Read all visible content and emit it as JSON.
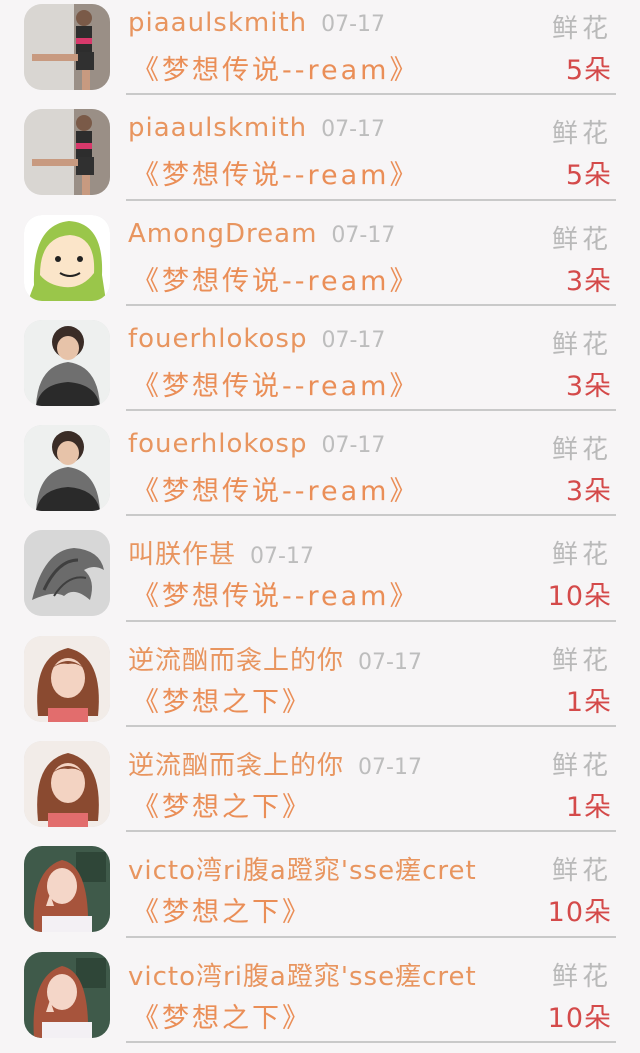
{
  "gifts": [
    {
      "name": "piaaulskmith",
      "date": "07-17",
      "work": "《梦想传说--ream》",
      "gift_label": "鲜花",
      "count": "5朵",
      "avatar": "athlete-photo"
    },
    {
      "name": "piaaulskmith",
      "date": "07-17",
      "work": "《梦想传说--ream》",
      "gift_label": "鲜花",
      "count": "5朵",
      "avatar": "athlete-photo"
    },
    {
      "name": "AmongDream",
      "date": "07-17",
      "work": "《梦想传说--ream》",
      "gift_label": "鲜花",
      "count": "3朵",
      "avatar": "green-hood-cartoon"
    },
    {
      "name": "fouerhlokosp",
      "date": "07-17",
      "work": "《梦想传说--ream》",
      "gift_label": "鲜花",
      "count": "3朵",
      "avatar": "hoodie-boy-photo"
    },
    {
      "name": "fouerhlokosp",
      "date": "07-17",
      "work": "《梦想传说--ream》",
      "gift_label": "鲜花",
      "count": "3朵",
      "avatar": "hoodie-boy-photo"
    },
    {
      "name": "叫朕作甚",
      "date": "07-17",
      "work": "《梦想传说--ream》",
      "gift_label": "鲜花",
      "count": "10朵",
      "avatar": "dragon-sketch"
    },
    {
      "name": "逆流酗而衾上的你",
      "date": "07-17",
      "work": "《梦想之下》",
      "gift_label": "鲜花",
      "count": "1朵",
      "avatar": "girl-photo"
    },
    {
      "name": "逆流酗而衾上的你",
      "date": "07-17",
      "work": "《梦想之下》",
      "gift_label": "鲜花",
      "count": "1朵",
      "avatar": "girl-photo"
    },
    {
      "name": "victo湾ri腹a蹬窕'sse瘥cret",
      "date": "07-17",
      "work": "《梦想之下》",
      "gift_label": "鲜花",
      "count": "10朵",
      "avatar": "girl-peace-sign-photo"
    },
    {
      "name": "victo湾ri腹a蹬窕'sse瘥cret",
      "date": "07-17",
      "work": "《梦想之下》",
      "gift_label": "鲜花",
      "count": "10朵",
      "avatar": "girl-peace-sign-photo"
    }
  ],
  "colors": {
    "name": "#e8955f",
    "count": "#d44a4a",
    "muted": "#bdbdbd",
    "divider": "#c9c9c9"
  }
}
